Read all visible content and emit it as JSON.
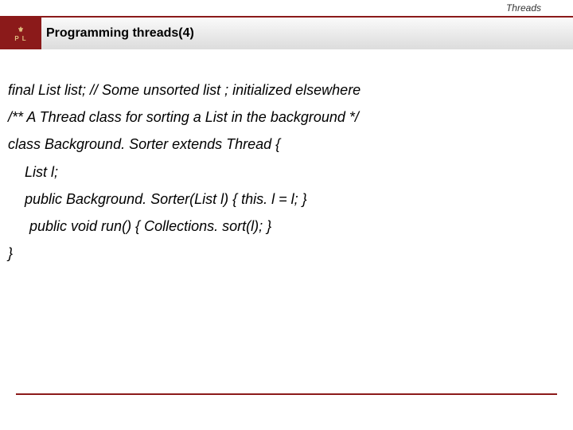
{
  "header": {
    "section_label": "Threads",
    "slide_title": "Programming threads(4)"
  },
  "logo": {
    "top": "⚜",
    "bottom": "P  L"
  },
  "code": {
    "l1": "final List list; // Some unsorted list ; initialized elsewhere",
    "l2": " /** A Thread class for sorting a List in the background */",
    "l3": "class Background. Sorter extends Thread {",
    "l4": "List l;",
    "l5": "public Background. Sorter(List l) { this. l = l; }",
    "l6": " public void run() { Collections. sort(l); }",
    "l7": "}"
  }
}
